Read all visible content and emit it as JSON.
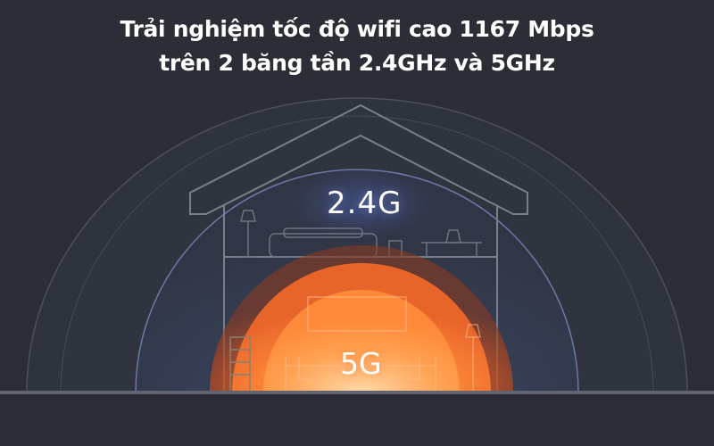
{
  "headline": {
    "line1": "Trải nghiệm tốc độ wifi cao 1167 Mbps",
    "line2": "trên 2 băng tần 2.4GHz và 5GHz"
  },
  "bands": {
    "band_24_label": "2.4G",
    "band_5_label": "5G"
  },
  "colors": {
    "background": "#2b2e36",
    "band_24_glow": "#3a4565",
    "band_5_core": "#ff8a3a",
    "band_5_outer": "#d9561c",
    "outline": "#7a7f8c"
  }
}
